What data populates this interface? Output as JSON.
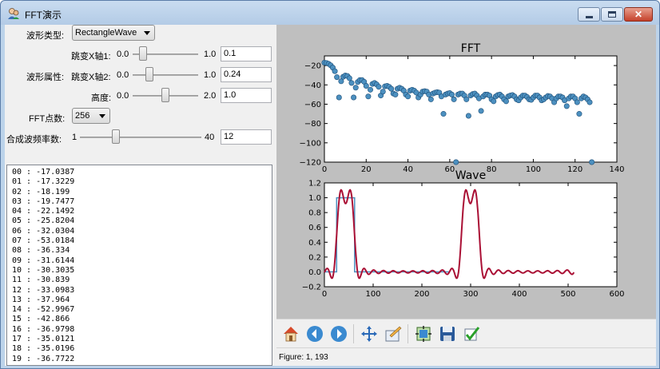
{
  "window": {
    "title": "FFT演示",
    "close_label": "✕"
  },
  "controls": {
    "wave_type": {
      "label": "波形类型:",
      "value": "RectangleWave"
    },
    "section_label": "波形属性:",
    "jump_x1": {
      "label": "跳变X轴1:",
      "min": "0.0",
      "max": "1.0",
      "value": "0.1",
      "fraction": 0.1
    },
    "jump_x2": {
      "label": "跳变X轴2:",
      "min": "0.0",
      "max": "1.0",
      "value": "0.24",
      "fraction": 0.24
    },
    "height": {
      "label": "高度:",
      "min": "0.0",
      "max": "2.0",
      "value": "1.0",
      "fraction": 0.5
    },
    "fft_points": {
      "label": "FFT点数:",
      "value": "256"
    },
    "synth_freq": {
      "label": "合成波频率数:",
      "min": "1",
      "max": "40",
      "value": "12",
      "fraction": 0.282
    }
  },
  "list": {
    "items": [
      "00 : -17.0387",
      "01 : -17.3229",
      "02 : -18.199",
      "03 : -19.7477",
      "04 : -22.1492",
      "05 : -25.8204",
      "06 : -32.0304",
      "07 : -53.0184",
      "08 : -36.334",
      "09 : -31.6144",
      "10 : -30.3035",
      "11 : -30.839",
      "12 : -33.0983",
      "13 : -37.964",
      "14 : -52.9967",
      "15 : -42.866",
      "16 : -36.9798",
      "17 : -35.0121",
      "18 : -35.0196",
      "19 : -36.7722"
    ]
  },
  "status": {
    "text": "Figure: 1, 193"
  },
  "toolbar": {
    "icons": [
      "home-icon",
      "back-icon",
      "forward-icon",
      "pan-icon",
      "zoom-icon",
      "subplots-icon",
      "save-icon",
      "check-icon"
    ]
  },
  "colors": {
    "scatter": "#4c90c0",
    "wave_square": "#4c90c0",
    "wave_synth": "#aa1035",
    "figure_bg": "#bfbfbf"
  },
  "chart_data": [
    {
      "type": "scatter",
      "title": "FFT",
      "xlim": [
        0,
        140
      ],
      "ylim": [
        -120,
        -10
      ],
      "xticks": [
        "0",
        "20",
        "40",
        "60",
        "80",
        "100",
        "120",
        "140"
      ],
      "yticks": [
        "-20",
        "-40",
        "-60",
        "-80",
        "-100",
        "-120"
      ],
      "x": [
        0,
        1,
        2,
        3,
        4,
        5,
        6,
        7,
        8,
        9,
        10,
        11,
        12,
        13,
        14,
        15,
        16,
        17,
        18,
        19,
        20,
        21,
        22,
        23,
        24,
        25,
        26,
        27,
        28,
        29,
        30,
        31,
        32,
        33,
        34,
        35,
        36,
        37,
        38,
        39,
        40,
        41,
        42,
        43,
        44,
        45,
        46,
        47,
        48,
        49,
        50,
        51,
        52,
        53,
        54,
        55,
        56,
        57,
        58,
        59,
        60,
        61,
        62,
        63,
        64,
        65,
        66,
        67,
        68,
        69,
        70,
        71,
        72,
        73,
        74,
        75,
        76,
        77,
        78,
        79,
        80,
        81,
        82,
        83,
        84,
        85,
        86,
        87,
        88,
        89,
        90,
        91,
        92,
        93,
        94,
        95,
        96,
        97,
        98,
        99,
        100,
        101,
        102,
        103,
        104,
        105,
        106,
        107,
        108,
        109,
        110,
        111,
        112,
        113,
        114,
        115,
        116,
        117,
        118,
        119,
        120,
        121,
        122,
        123,
        124,
        125,
        126,
        127,
        128
      ],
      "values": [
        -17.0,
        -17.3,
        -18.2,
        -19.7,
        -22.1,
        -25.8,
        -32.0,
        -53.0,
        -36.3,
        -31.6,
        -30.3,
        -30.8,
        -33.1,
        -38.0,
        -53.0,
        -42.9,
        -37.0,
        -35.0,
        -35.0,
        -36.8,
        -41.0,
        -52.0,
        -45.0,
        -39.0,
        -38.0,
        -39.5,
        -42.0,
        -51.0,
        -47.0,
        -41.5,
        -41.0,
        -42.0,
        -44.0,
        -49.0,
        -50.0,
        -44.0,
        -43.0,
        -44.0,
        -46.0,
        -50.0,
        -52.0,
        -46.0,
        -45.0,
        -46.0,
        -48.0,
        -53.0,
        -50.0,
        -47.0,
        -46.5,
        -47.0,
        -50.0,
        -55.0,
        -49.0,
        -48.0,
        -47.5,
        -48.0,
        -52.0,
        -70.0,
        -50.0,
        -49.0,
        -48.5,
        -50.0,
        -55.0,
        -120.0,
        -50.0,
        -49.0,
        -49.0,
        -51.0,
        -55.0,
        -72.0,
        -51.0,
        -49.5,
        -49.0,
        -51.0,
        -54.0,
        -67.0,
        -52.0,
        -50.0,
        -50.0,
        -51.0,
        -55.0,
        -57.0,
        -52.0,
        -50.5,
        -50.0,
        -52.0,
        -55.0,
        -57.0,
        -52.0,
        -51.0,
        -50.5,
        -52.0,
        -55.0,
        -56.0,
        -53.0,
        -51.0,
        -51.0,
        -52.5,
        -55.0,
        -55.5,
        -53.0,
        -51.0,
        -51.0,
        -53.0,
        -56.0,
        -55.0,
        -53.0,
        -51.5,
        -52.0,
        -54.0,
        -58.0,
        -54.0,
        -52.0,
        -52.0,
        -53.0,
        -56.0,
        -62.0,
        -54.0,
        -52.0,
        -52.0,
        -54.0,
        -58.0,
        -70.0,
        -54.0,
        -52.0,
        -53.0,
        -55.0,
        -58.0,
        -120.0
      ]
    },
    {
      "type": "line",
      "title": "Wave",
      "xlim": [
        0,
        600
      ],
      "ylim": [
        -0.2,
        1.2
      ],
      "xticks": [
        "0",
        "100",
        "200",
        "300",
        "400",
        "500",
        "600"
      ],
      "yticks": [
        "1.2",
        "1.0",
        "0.8",
        "0.6",
        "0.4",
        "0.2",
        "0.0",
        "-0.2"
      ],
      "series": [
        {
          "x": [
            0,
            25,
            25,
            62,
            62,
            256
          ],
          "values": [
            0,
            0,
            1,
            1,
            0,
            0
          ]
        },
        {
          "period": 256,
          "x_max": 512,
          "terms": 12,
          "high_start": 25,
          "high_end": 62,
          "length_hint": 256
        }
      ]
    }
  ]
}
